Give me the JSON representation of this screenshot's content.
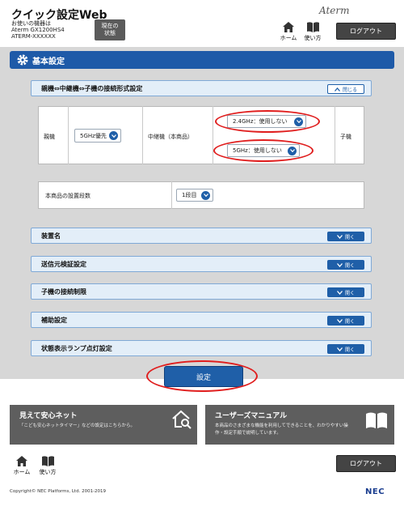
{
  "header": {
    "title": "クイック設定Web",
    "device_caption": "お使いの機器は",
    "device_model": "Aterm GX1200HS4",
    "device_id": "ATERM-XXXXXX",
    "status_button": "現在の状態",
    "home_label": "ホーム",
    "help_label": "使い方",
    "logo": "Aterm",
    "logout": "ログアウト"
  },
  "page": {
    "section_title": "基本設定"
  },
  "connection": {
    "title": "親機⇔中継機⇔子機の接続形式設定",
    "close_label": "閉じる",
    "parent_label": "親機",
    "parent_value": "5GHz優先",
    "relay_label": "中継機（本商品）",
    "relay_24": "2.4GHz：使用しない",
    "relay_5": "5GHz：使用しない",
    "child_label": "子機",
    "stages_label": "本商品の設置段数",
    "stages_value": "1段目"
  },
  "sections": [
    {
      "title": "装置名",
      "open": "開く"
    },
    {
      "title": "送信元検証設定",
      "open": "開く"
    },
    {
      "title": "子機の接続制限",
      "open": "開く"
    },
    {
      "title": "補助設定",
      "open": "開く"
    },
    {
      "title": "状態表示ランプ点灯設定",
      "open": "開く"
    }
  ],
  "submit_label": "設定",
  "info": {
    "left_title": "見えて安心ネット",
    "left_desc": "「こども安心ネットタイマー」などの設定はこちらから。",
    "right_title": "ユーザーズマニュアル",
    "right_desc1": "本商品のさまざまな機能を利用してできることを、わかりやすい操",
    "right_desc2": "作・設定手順で説明しています。"
  },
  "footer": {
    "home_label": "ホーム",
    "help_label": "使い方",
    "logout": "ログアウト",
    "copyright": "Copyright© NEC Platforms, Ltd. 2001-2019",
    "brand": "NEC"
  },
  "colors": {
    "accent": "#1f5fa8",
    "highlight": "#e01e1e",
    "dark_button": "#444444"
  }
}
